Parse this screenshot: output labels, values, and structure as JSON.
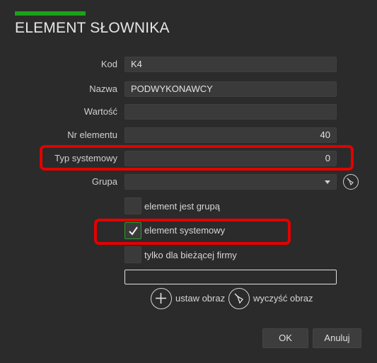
{
  "dialog": {
    "title": "ELEMENT SŁOWNIKA"
  },
  "fields": {
    "kod": {
      "label": "Kod",
      "value": "K4"
    },
    "nazwa": {
      "label": "Nazwa",
      "value": "PODWYKONAWCY"
    },
    "wartosc": {
      "label": "Wartość",
      "value": ""
    },
    "nr_elementu": {
      "label": "Nr elementu",
      "value": "40"
    },
    "typ_systemowy": {
      "label": "Typ systemowy",
      "value": "0"
    },
    "grupa": {
      "label": "Grupa",
      "value": ""
    }
  },
  "checkboxes": {
    "element_jest_grupa": {
      "label": "element jest grupą",
      "checked": false
    },
    "element_systemowy": {
      "label": "element systemowy",
      "checked": true
    },
    "tylko_biezacej_firmy": {
      "label": "tylko dla bieżącej firmy",
      "checked": false
    }
  },
  "image": {
    "set_label": "ustaw obraz",
    "clear_label": "wyczyść obraz"
  },
  "buttons": {
    "ok": "OK",
    "cancel": "Anuluj"
  },
  "colors": {
    "accent": "#1aa31a",
    "highlight": "#e30000",
    "background": "#2b2b2b"
  },
  "icons": {
    "grupa_clear": "broom-icon",
    "set_image": "plus-icon",
    "clear_image": "broom-icon",
    "check": "checkmark-icon",
    "dropdown": "chevron-down-icon"
  }
}
